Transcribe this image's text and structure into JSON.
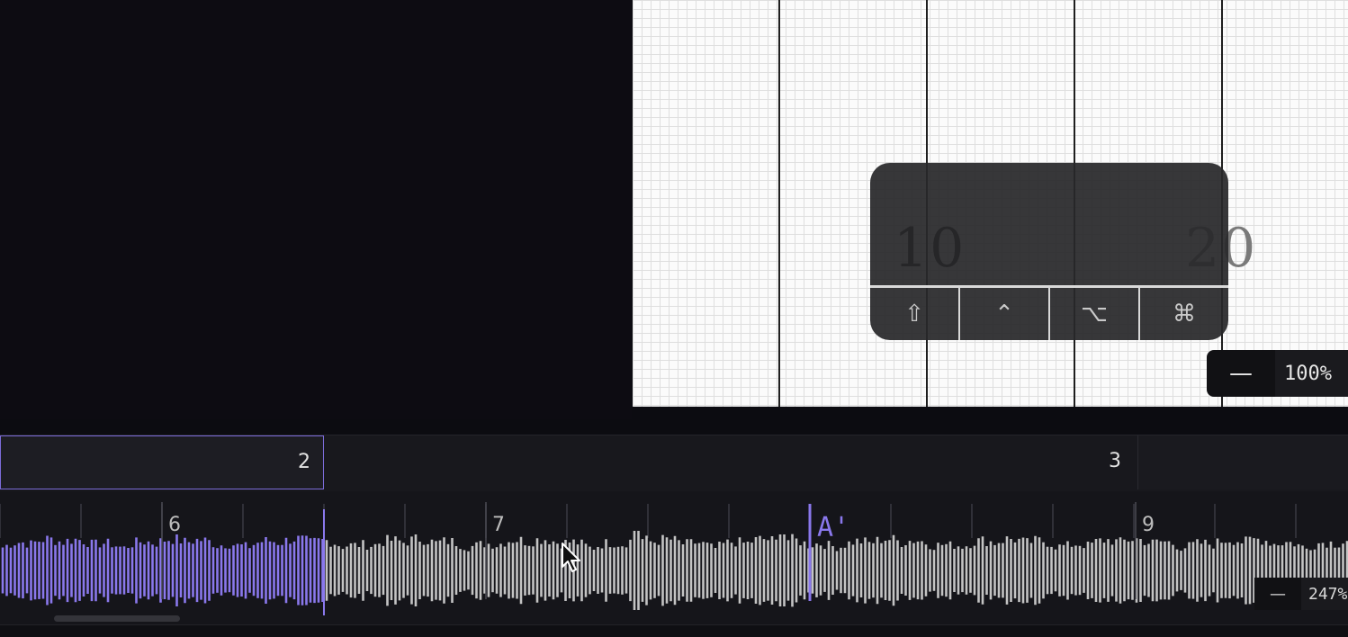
{
  "score": {
    "measure_left": "10",
    "measure_right": "20"
  },
  "modifier_keys": [
    {
      "symbol": "⇧",
      "icon": "shift-icon"
    },
    {
      "symbol": "⌃",
      "icon": "control-icon"
    },
    {
      "symbol": "⌥",
      "icon": "option-icon"
    },
    {
      "symbol": "⌘",
      "icon": "command-icon"
    }
  ],
  "zoom": {
    "out_symbol": "—",
    "value": "100%"
  },
  "sections": [
    {
      "label": "2"
    },
    {
      "label": "3"
    }
  ],
  "timeline": {
    "beat_markers": [
      {
        "label": "6",
        "time": 180
      },
      {
        "label": "7",
        "time": 540
      },
      {
        "label": "9",
        "time": 1262
      }
    ],
    "rehearsal_mark": {
      "label": "A'",
      "time": 900
    },
    "playhead_time": 360
  },
  "waveform_zoom": {
    "out_symbol": "—",
    "value": "247%"
  },
  "colors": {
    "accent": "#8a78ec",
    "waveform_played": "#8a78ec",
    "waveform_unplayed": "#c4c4c4"
  }
}
